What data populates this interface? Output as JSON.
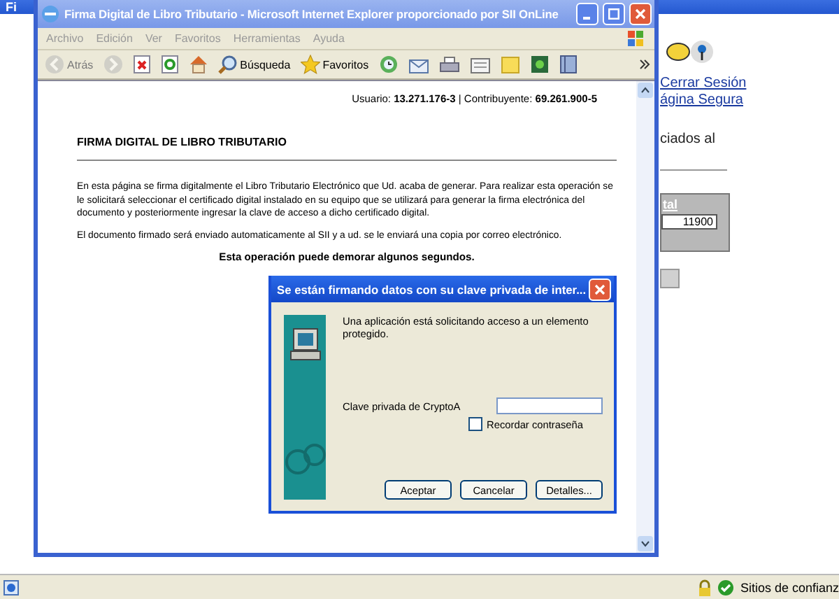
{
  "background_window": {
    "title": "Fi",
    "links": [
      "Cerrar Sesión",
      "ágina Segura"
    ],
    "text": "ciados al",
    "table": {
      "header": "tal",
      "cell": "11900"
    },
    "status_bar": {
      "zone": "Sitios de confianz"
    }
  },
  "window": {
    "title": "Firma Digital de Libro Tributario - Microsoft Internet Explorer proporcionado por SII OnLine",
    "menu": [
      "Archivo",
      "Edición",
      "Ver",
      "Favoritos",
      "Herramientas",
      "Ayuda"
    ],
    "toolbar": [
      {
        "kind": "back",
        "label": "Atrás",
        "disabled": true
      },
      {
        "kind": "forward",
        "disabled": true
      },
      {
        "kind": "stop",
        "disabled": false
      },
      {
        "kind": "refresh",
        "disabled": false
      },
      {
        "kind": "home",
        "disabled": false
      },
      {
        "kind": "search",
        "label": "Búsqueda",
        "disabled": false
      },
      {
        "kind": "favorites",
        "label": "Favoritos",
        "disabled": false
      },
      {
        "kind": "history",
        "disabled": false
      },
      {
        "kind": "mail",
        "disabled": false
      },
      {
        "kind": "print",
        "disabled": false
      },
      {
        "kind": "edit",
        "disabled": false
      },
      {
        "kind": "note",
        "disabled": false
      },
      {
        "kind": "messenger",
        "disabled": false
      },
      {
        "kind": "research",
        "disabled": false
      }
    ],
    "page": {
      "user_line": "Usuario: **13.271.176-3** | Contribuyente: **69.261.900-5**",
      "heading": "FIRMA DIGITAL DE LIBRO TRIBUTARIO",
      "paragraphs": [
        "En esta página se firma digitalmente el Libro Tributario Electrónico que Ud. acaba de generar. Para realizar esta operación se le solicitará seleccionar el certificado digital instalado en su equipo que se utilizará para generar la firma electrónica del documento y posteriormente ingresar la clave de acceso a dicho certificado digital.",
        "El documento firmado será enviado automaticamente al SII y a ud. se le enviará una copia por correo electrónico."
      ],
      "note": "Esta operación puede demorar algunos segundos."
    }
  },
  "dialog": {
    "title": "Se están firmando datos con su clave privada de inter...",
    "message": "Una aplicación está solicitando acceso a un elemento protegido.",
    "field_label": "Clave privada de CryptoA",
    "remember": {
      "label": "Recordar contraseña",
      "checked": false
    },
    "buttons": [
      "Aceptar",
      "Cancelar",
      "Detalles..."
    ]
  }
}
